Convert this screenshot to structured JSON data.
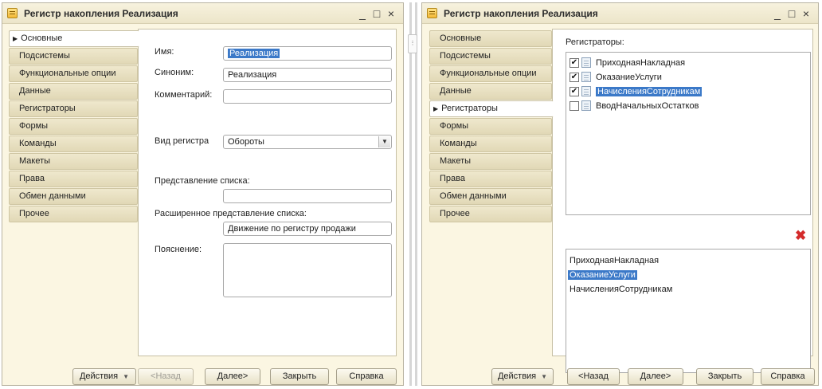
{
  "left": {
    "title": "Регистр накопления Реализация",
    "tabs": [
      "Основные",
      "Подсистемы",
      "Функциональные опции",
      "Данные",
      "Регистраторы",
      "Формы",
      "Команды",
      "Макеты",
      "Права",
      "Обмен данными",
      "Прочее"
    ],
    "active_tab": "Основные",
    "form": {
      "name_label": "Имя:",
      "name_value": "Реализация",
      "synonym_label": "Синоним:",
      "synonym_value": "Реализация",
      "comment_label": "Комментарий:",
      "comment_value": "",
      "kind_label": "Вид регистра",
      "kind_value": "Обороты",
      "list_repr_label": "Представление списка:",
      "list_repr_value": "",
      "ext_list_repr_label": "Расширенное представление списка:",
      "ext_list_repr_value": "Движение по регистру продажи",
      "explanation_label": "Пояснение:",
      "explanation_value": ""
    },
    "footer": {
      "actions": "Действия",
      "back": "<Назад",
      "next": "Далее>",
      "close": "Закрыть",
      "help": "Справка"
    }
  },
  "right": {
    "title": "Регистр накопления Реализация",
    "tabs": [
      "Основные",
      "Подсистемы",
      "Функциональные опции",
      "Данные",
      "Регистраторы",
      "Формы",
      "Команды",
      "Макеты",
      "Права",
      "Обмен данными",
      "Прочее"
    ],
    "active_tab": "Регистраторы",
    "registrators_label": "Регистраторы:",
    "registrators": [
      {
        "name": "ПриходнаяНакладная",
        "checked": true,
        "selected": false
      },
      {
        "name": "ОказаниеУслуги",
        "checked": true,
        "selected": false
      },
      {
        "name": "НачисленияСотрудникам",
        "checked": true,
        "selected": true
      },
      {
        "name": "ВводНачальныхОстатков",
        "checked": false,
        "selected": false
      }
    ],
    "selected_list": [
      {
        "name": "ПриходнаяНакладная",
        "selected": false
      },
      {
        "name": "ОказаниеУслуги",
        "selected": true
      },
      {
        "name": "НачисленияСотрудникам",
        "selected": false
      }
    ],
    "footer": {
      "actions": "Действия",
      "back": "<Назад",
      "next": "Далее>",
      "close": "Закрыть",
      "help": "Справка"
    }
  },
  "window_buttons": {
    "minimize": "_",
    "maximize": "□",
    "close": "×"
  },
  "colors": {
    "window_bg": "#fbf6e2",
    "selection": "#3b79c8",
    "delete": "#d42b2b"
  }
}
